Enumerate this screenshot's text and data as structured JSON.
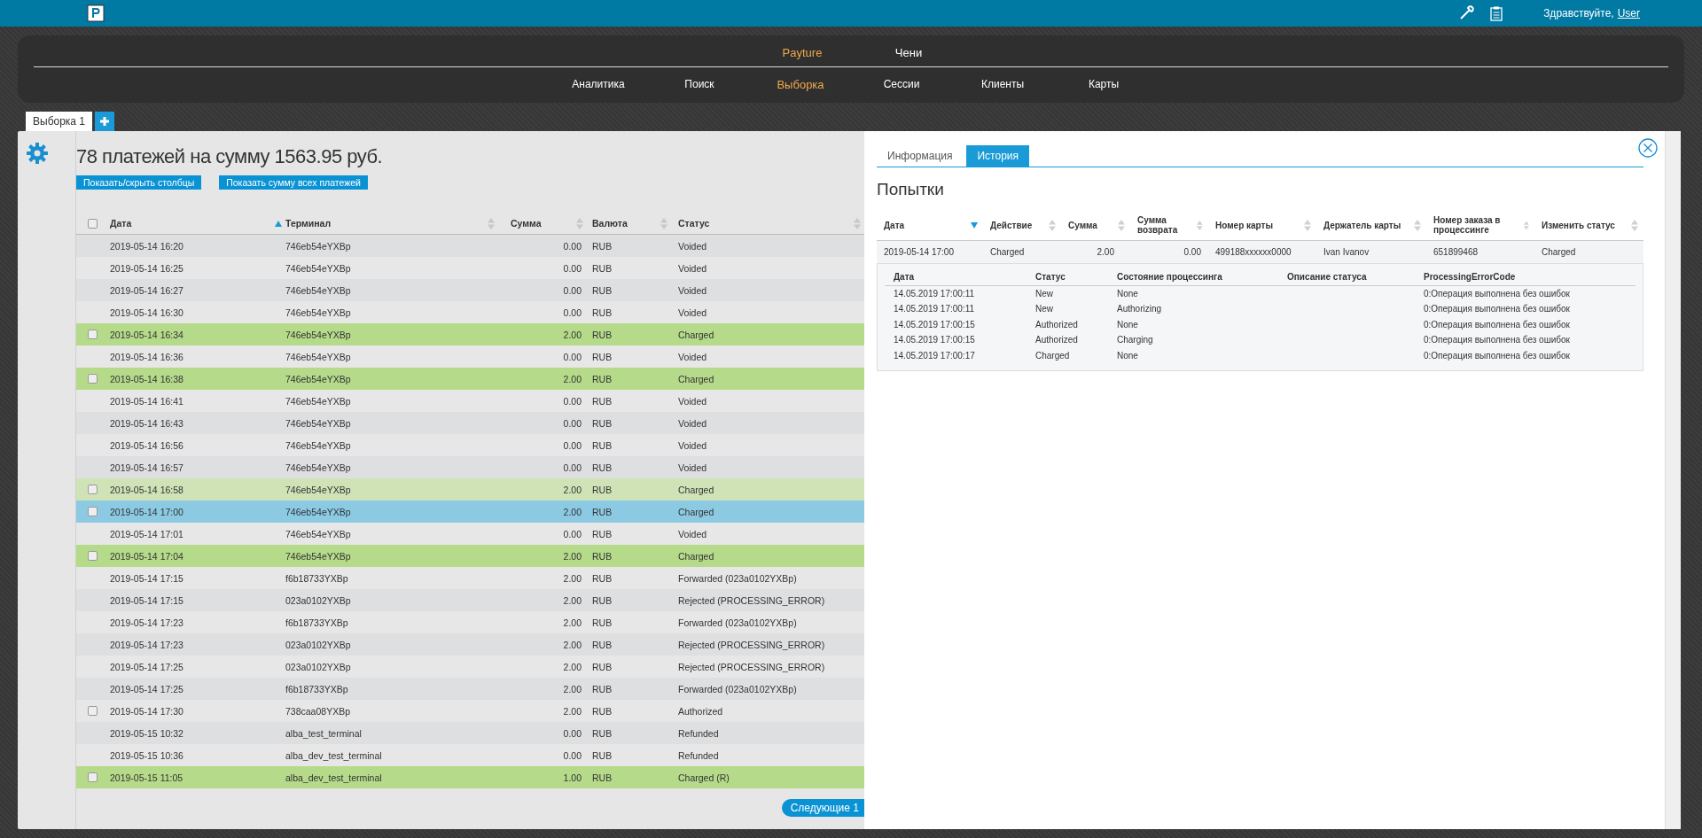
{
  "header": {
    "greeting": "Здравствуйте,",
    "user_link": "User"
  },
  "nav": {
    "top": [
      {
        "label": "Payture",
        "selected": true
      },
      {
        "label": "Чени",
        "selected": false
      }
    ],
    "sub": [
      {
        "label": "Аналитика",
        "selected": false
      },
      {
        "label": "Поиск",
        "selected": false
      },
      {
        "label": "Выборка",
        "selected": true
      },
      {
        "label": "Сессии",
        "selected": false
      },
      {
        "label": "Клиенты",
        "selected": false
      },
      {
        "label": "Карты",
        "selected": false
      }
    ]
  },
  "tabs": [
    {
      "label": "Выборка 1",
      "selected": true
    }
  ],
  "summary": {
    "title": "78 платежей на сумму 1563.95 руб.",
    "buttons": [
      "Показать/скрыть столбцы",
      "Показать сумму всех платежей"
    ]
  },
  "table": {
    "select_all": {
      "checked": false
    },
    "sort_descending": false,
    "columns": [
      {
        "label": "Дата",
        "sorted": true
      },
      {
        "label": "Терминал",
        "sorted": false
      },
      {
        "label": "Сумма",
        "sorted": false
      },
      {
        "label": "Валюта",
        "sorted": false
      },
      {
        "label": "Статус",
        "sorted": false
      }
    ],
    "rows": [
      {
        "kind": "plain",
        "cells": [
          "2019-05-14 16:20",
          "746eb54eYXBp",
          "0.00",
          "RUB",
          "Voided"
        ]
      },
      {
        "kind": "plain",
        "cells": [
          "2019-05-14 16:25",
          "746eb54eYXBp",
          "0.00",
          "RUB",
          "Voided"
        ]
      },
      {
        "kind": "plain",
        "cells": [
          "2019-05-14 16:27",
          "746eb54eYXBp",
          "0.00",
          "RUB",
          "Voided"
        ]
      },
      {
        "kind": "plain",
        "cells": [
          "2019-05-14 16:30",
          "746eb54eYXBp",
          "0.00",
          "RUB",
          "Voided"
        ]
      },
      {
        "kind": "success",
        "checked": false,
        "cells": [
          "2019-05-14 16:34",
          "746eb54eYXBp",
          "2.00",
          "RUB",
          "Charged"
        ]
      },
      {
        "kind": "plain",
        "cells": [
          "2019-05-14 16:36",
          "746eb54eYXBp",
          "0.00",
          "RUB",
          "Voided"
        ]
      },
      {
        "kind": "success",
        "checked": false,
        "cells": [
          "2019-05-14 16:38",
          "746eb54eYXBp",
          "2.00",
          "RUB",
          "Charged"
        ]
      },
      {
        "kind": "plain",
        "cells": [
          "2019-05-14 16:41",
          "746eb54eYXBp",
          "0.00",
          "RUB",
          "Voided"
        ]
      },
      {
        "kind": "plain",
        "cells": [
          "2019-05-14 16:43",
          "746eb54eYXBp",
          "0.00",
          "RUB",
          "Voided"
        ]
      },
      {
        "kind": "plain",
        "cells": [
          "2019-05-14 16:56",
          "746eb54eYXBp",
          "0.00",
          "RUB",
          "Voided"
        ]
      },
      {
        "kind": "plain",
        "cells": [
          "2019-05-14 16:57",
          "746eb54eYXBp",
          "0.00",
          "RUB",
          "Voided"
        ]
      },
      {
        "kind": "success_light",
        "checked": false,
        "cells": [
          "2019-05-14 16:58",
          "746eb54eYXBp",
          "2.00",
          "RUB",
          "Charged"
        ]
      },
      {
        "kind": "selected",
        "checked": false,
        "cells": [
          "2019-05-14 17:00",
          "746eb54eYXBp",
          "2.00",
          "RUB",
          "Charged"
        ]
      },
      {
        "kind": "plain",
        "cells": [
          "2019-05-14 17:01",
          "746eb54eYXBp",
          "0.00",
          "RUB",
          "Voided"
        ]
      },
      {
        "kind": "success",
        "checked": false,
        "cells": [
          "2019-05-14 17:04",
          "746eb54eYXBp",
          "2.00",
          "RUB",
          "Charged"
        ]
      },
      {
        "kind": "plain",
        "cells": [
          "2019-05-14 17:15",
          "f6b18733YXBp",
          "2.00",
          "RUB",
          "Forwarded (023a0102YXBp)"
        ]
      },
      {
        "kind": "plain",
        "cells": [
          "2019-05-14 17:15",
          "023a0102YXBp",
          "2.00",
          "RUB",
          "Rejected (PROCESSING_ERROR)"
        ]
      },
      {
        "kind": "plain",
        "cells": [
          "2019-05-14 17:23",
          "f6b18733YXBp",
          "2.00",
          "RUB",
          "Forwarded (023a0102YXBp)"
        ]
      },
      {
        "kind": "plain",
        "cells": [
          "2019-05-14 17:23",
          "023a0102YXBp",
          "2.00",
          "RUB",
          "Rejected (PROCESSING_ERROR)"
        ]
      },
      {
        "kind": "plain",
        "cells": [
          "2019-05-14 17:25",
          "023a0102YXBp",
          "2.00",
          "RUB",
          "Rejected (PROCESSING_ERROR)"
        ]
      },
      {
        "kind": "plain",
        "cells": [
          "2019-05-14 17:25",
          "f6b18733YXBp",
          "2.00",
          "RUB",
          "Forwarded (023a0102YXBp)"
        ]
      },
      {
        "kind": "plain",
        "checked": false,
        "cells": [
          "2019-05-14 17:30",
          "738caa08YXBp",
          "2.00",
          "RUB",
          "Authorized"
        ]
      },
      {
        "kind": "plain",
        "cells": [
          "2019-05-15 10:32",
          "alba_test_terminal",
          "0.00",
          "RUB",
          "Refunded"
        ]
      },
      {
        "kind": "plain",
        "cells": [
          "2019-05-15 10:36",
          "alba_dev_test_terminal",
          "0.00",
          "RUB",
          "Refunded"
        ]
      },
      {
        "kind": "success",
        "checked": false,
        "cells": [
          "2019-05-15 11:05",
          "alba_dev_test_terminal",
          "1.00",
          "RUB",
          "Charged (R)"
        ]
      }
    ]
  },
  "next_button": "Следующие 1",
  "detail": {
    "tabs": [
      {
        "label": "Информация",
        "selected": false
      },
      {
        "label": "История",
        "selected": true
      }
    ],
    "heading": "Попытки",
    "sort_descending": true,
    "columns": [
      {
        "label": "Дата",
        "sorted": true
      },
      {
        "label": "Действие",
        "sorted": false
      },
      {
        "label": "Сумма",
        "sorted": false
      },
      {
        "label": "Сумма возврата",
        "sorted": false
      },
      {
        "label": "Номер карты",
        "sorted": false
      },
      {
        "label": "Держатель карты",
        "sorted": false
      },
      {
        "label": "Номер заказа в процессинге",
        "sorted": false
      },
      {
        "label": "Изменить статус",
        "sorted": false
      }
    ],
    "rows": [
      {
        "cells": [
          "2019-05-14 17:00",
          "Charged",
          "2.00",
          "0.00",
          "499188xxxxxx0000",
          "Ivan Ivanov",
          "651899468",
          "Charged"
        ],
        "history": {
          "columns": [
            "Дата",
            "Статус",
            "Состояние процессинга",
            "Описание статуса",
            "ProcessingErrorCode"
          ],
          "rows": [
            [
              "14.05.2019 17:00:11",
              "New",
              "None",
              "",
              "0:Операция выполнена без ошибок"
            ],
            [
              "14.05.2019 17:00:11",
              "New",
              "Authorizing",
              "",
              "0:Операция выполнена без ошибок"
            ],
            [
              "14.05.2019 17:00:15",
              "Authorized",
              "None",
              "",
              "0:Операция выполнена без ошибок"
            ],
            [
              "14.05.2019 17:00:15",
              "Authorized",
              "Charging",
              "",
              "0:Операция выполнена без ошибок"
            ],
            [
              "14.05.2019 17:00:17",
              "Charged",
              "None",
              "",
              "0:Операция выполнена без ошибок"
            ]
          ]
        }
      }
    ]
  }
}
